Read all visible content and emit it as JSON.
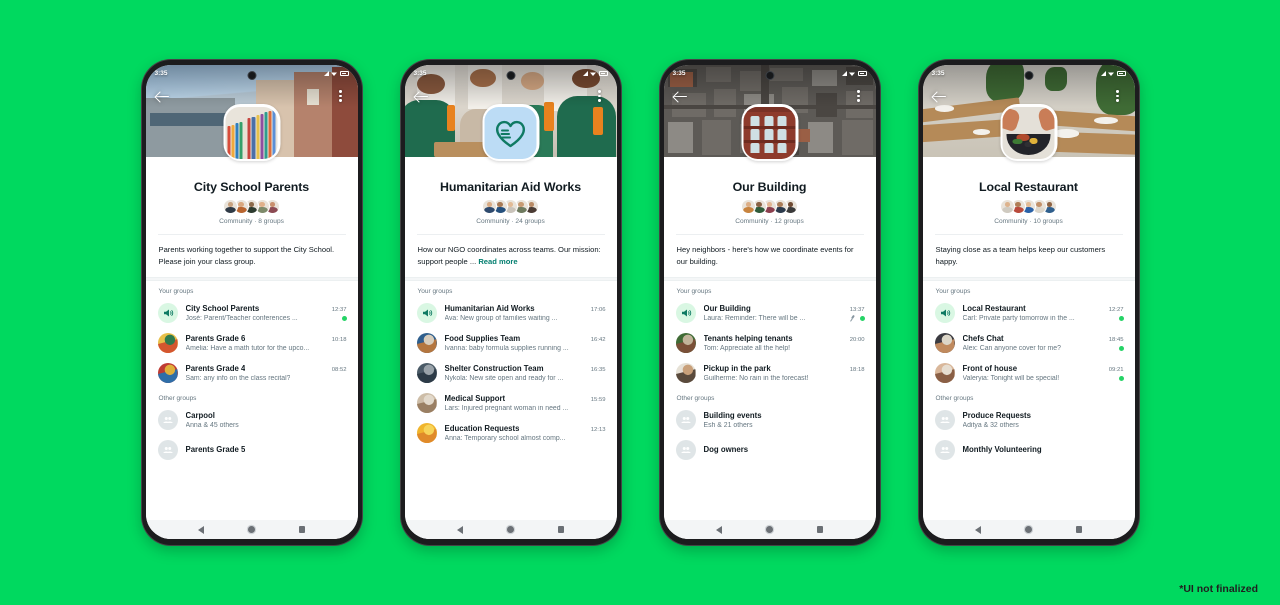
{
  "background_color": "#00D95F",
  "watermark": "*UI not finalized",
  "status_bar": {
    "time": "3:35"
  },
  "nav_bar": {
    "back": "back-icon",
    "home": "home-icon",
    "recents": "recents-icon"
  },
  "labels": {
    "your_groups": "Your groups",
    "other_groups": "Other groups",
    "read_more": "Read more"
  },
  "accent": {
    "teal": "#027e6f",
    "unread_green": "#25D366",
    "badge_bg": "#d9f7e3"
  },
  "phones": [
    {
      "id": "city-school-parents",
      "cover": "school-building-photo",
      "avatar": "bookshelf-photo",
      "title": "City School Parents",
      "subtitle": "Community · 8 groups",
      "description": "Parents working together to support the City School. Please join your class group.",
      "has_read_more": false,
      "your_groups": [
        {
          "name": "City School Parents",
          "time": "12:37",
          "message": "José: Parent/Teacher conferences ...",
          "avatar": "announcement-icon",
          "unread": true,
          "pinned": false
        },
        {
          "name": "Parents Grade 6",
          "time": "10:18",
          "message": "Amelia: Have a math tutor for the upco...",
          "avatar": "photo-kids-art",
          "unread": false,
          "pinned": false
        },
        {
          "name": "Parents Grade 4",
          "time": "08:52",
          "message": "Sam: any info on the class recital?",
          "avatar": "photo-kids-group",
          "unread": false,
          "pinned": false
        }
      ],
      "other_groups": [
        {
          "name": "Carpool",
          "members": "Anna & 45 others"
        },
        {
          "name": "Parents Grade 5",
          "members": ""
        }
      ]
    },
    {
      "id": "humanitarian-aid-works",
      "cover": "volunteers-packing-photo",
      "avatar": "heart-hand-logo",
      "title": "Humanitarian Aid Works",
      "subtitle": "Community · 24 groups",
      "description": "How our NGO coordinates across teams. Our mission: support people ...",
      "has_read_more": true,
      "your_groups": [
        {
          "name": "Humanitarian Aid Works",
          "time": "17:06",
          "message": "Ava: New group of families waiting ...",
          "avatar": "announcement-icon",
          "unread": false,
          "pinned": false
        },
        {
          "name": "Food Supplies Team",
          "time": "16:42",
          "message": "Ivanna: baby formula supplies running ...",
          "avatar": "photo-supplies",
          "unread": false,
          "pinned": false
        },
        {
          "name": "Shelter Construction Team",
          "time": "16:35",
          "message": "Nykola: New site open and ready for ...",
          "avatar": "photo-construction",
          "unread": false,
          "pinned": false
        },
        {
          "name": "Medical Support",
          "time": "15:59",
          "message": "Lars: Injured pregnant woman in need ...",
          "avatar": "photo-medical",
          "unread": false,
          "pinned": false
        },
        {
          "name": "Education Requests",
          "time": "12:13",
          "message": "Anna: Temporary school almost comp...",
          "avatar": "photo-education",
          "unread": false,
          "pinned": false
        }
      ],
      "other_groups": []
    },
    {
      "id": "our-building",
      "cover": "aerial-city-photo",
      "avatar": "red-brick-building-photo",
      "title": "Our Building",
      "subtitle": "Community · 12 groups",
      "description": "Hey neighbors - here's how we coordinate events for our building.",
      "has_read_more": false,
      "your_groups": [
        {
          "name": "Our Building",
          "time": "13:37",
          "message": "Laura: Reminder:  There will be ...",
          "avatar": "announcement-icon",
          "unread": true,
          "pinned": true
        },
        {
          "name": "Tenants helping tenants",
          "time": "20:00",
          "message": "Tom: Appreciate all the help!",
          "avatar": "photo-plants",
          "unread": false,
          "pinned": false
        },
        {
          "name": "Pickup in the park",
          "time": "18:18",
          "message": "Guilherme: No rain in the forecast!",
          "avatar": "photo-dog",
          "unread": false,
          "pinned": false
        }
      ],
      "other_groups": [
        {
          "name": "Building events",
          "members": "Esh & 21 others"
        },
        {
          "name": "Dog owners",
          "members": ""
        }
      ]
    },
    {
      "id": "local-restaurant",
      "cover": "restaurant-tables-photo",
      "avatar": "plated-food-photo",
      "title": "Local Restaurant",
      "subtitle": "Community · 10 groups",
      "description": "Staying close as a team helps keep our customers happy.",
      "has_read_more": false,
      "your_groups": [
        {
          "name": "Local Restaurant",
          "time": "12:27",
          "message": "Carl: Private party tomorrow in the ...",
          "avatar": "announcement-icon",
          "unread": true,
          "pinned": false
        },
        {
          "name": "Chefs Chat",
          "time": "18:45",
          "message": "Alex: Can anyone cover for me?",
          "avatar": "photo-chefs",
          "unread": true,
          "pinned": false
        },
        {
          "name": "Front of house",
          "time": "09:21",
          "message": "Valeryia: Tonight will be special!",
          "avatar": "photo-staff",
          "unread": true,
          "pinned": false
        }
      ],
      "other_groups": [
        {
          "name": "Produce Requests",
          "members": "Aditya & 32 others"
        },
        {
          "name": "Monthly Volunteering",
          "members": ""
        }
      ]
    }
  ]
}
